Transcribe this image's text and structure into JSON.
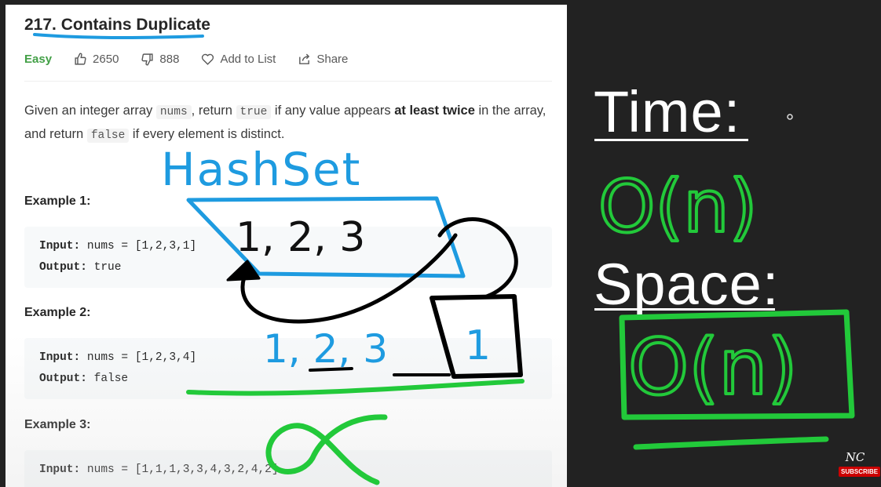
{
  "problem": {
    "title": "217. Contains Duplicate",
    "difficulty": "Easy",
    "likes": "2650",
    "dislikes": "888",
    "add_to_list": "Add to List",
    "share": "Share"
  },
  "description": {
    "part1": "Given an integer array ",
    "code1": "nums",
    "part2": ", return ",
    "code2": "true",
    "part3": " if any value appears ",
    "bold": "at least twice",
    "part4": " in the array, and return ",
    "code3": "false",
    "part5": " if every element is distinct."
  },
  "examples": [
    {
      "title": "Example 1:",
      "input_label": "Input:",
      "input": " nums = [1,2,3,1]",
      "output_label": "Output:",
      "output": " true"
    },
    {
      "title": "Example 2:",
      "input_label": "Input:",
      "input": " nums = [1,2,3,4]",
      "output_label": "Output:",
      "output": " false"
    },
    {
      "title": "Example 3:",
      "input_label": "Input:",
      "input": " nums = [1,1,1,3,3,4,3,2,4,2]"
    }
  ],
  "whiteboard": {
    "time_label": "Time:",
    "space_label": "Space:",
    "hashset_text": "HashSet",
    "hashset_items": "1, 2, 3",
    "array_items": "1, 2, 3",
    "box_item": "1",
    "time_complexity": "O(n)",
    "space_complexity": "O(n)",
    "colors": {
      "blue": "#1e9be0",
      "green": "#22c93a",
      "black": "#000000"
    }
  },
  "channel": {
    "logo": "NC",
    "subscribe": "SUBSCRIBE"
  }
}
